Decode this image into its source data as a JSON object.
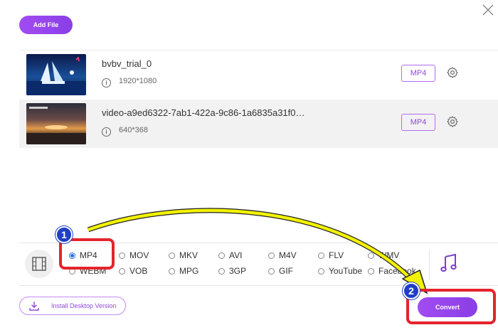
{
  "toolbar": {
    "add_file_label": "Add File"
  },
  "files": [
    {
      "name": "bvbv_trial_0",
      "resolution": "1920*1080",
      "format": "MP4"
    },
    {
      "name": "video-a9ed6322-7ab1-422a-9c86-1a6835a31f0…",
      "resolution": "640*368",
      "format": "MP4"
    }
  ],
  "formats": {
    "row1": [
      "MP4",
      "MOV",
      "MKV",
      "AVI",
      "M4V",
      "FLV",
      "WMV"
    ],
    "row2": [
      "WEBM",
      "VOB",
      "MPG",
      "3GP",
      "GIF",
      "YouTube",
      "Facebook"
    ],
    "selected": "MP4"
  },
  "footer": {
    "install_label": "Install Desktop Version",
    "convert_label": "Convert"
  },
  "annotations": {
    "step1": "1",
    "step2": "2"
  },
  "colors": {
    "accent": "#9b47ee",
    "highlight": "#e3242b",
    "arrow": "#f0f000",
    "badge": "#1f3fc7"
  }
}
